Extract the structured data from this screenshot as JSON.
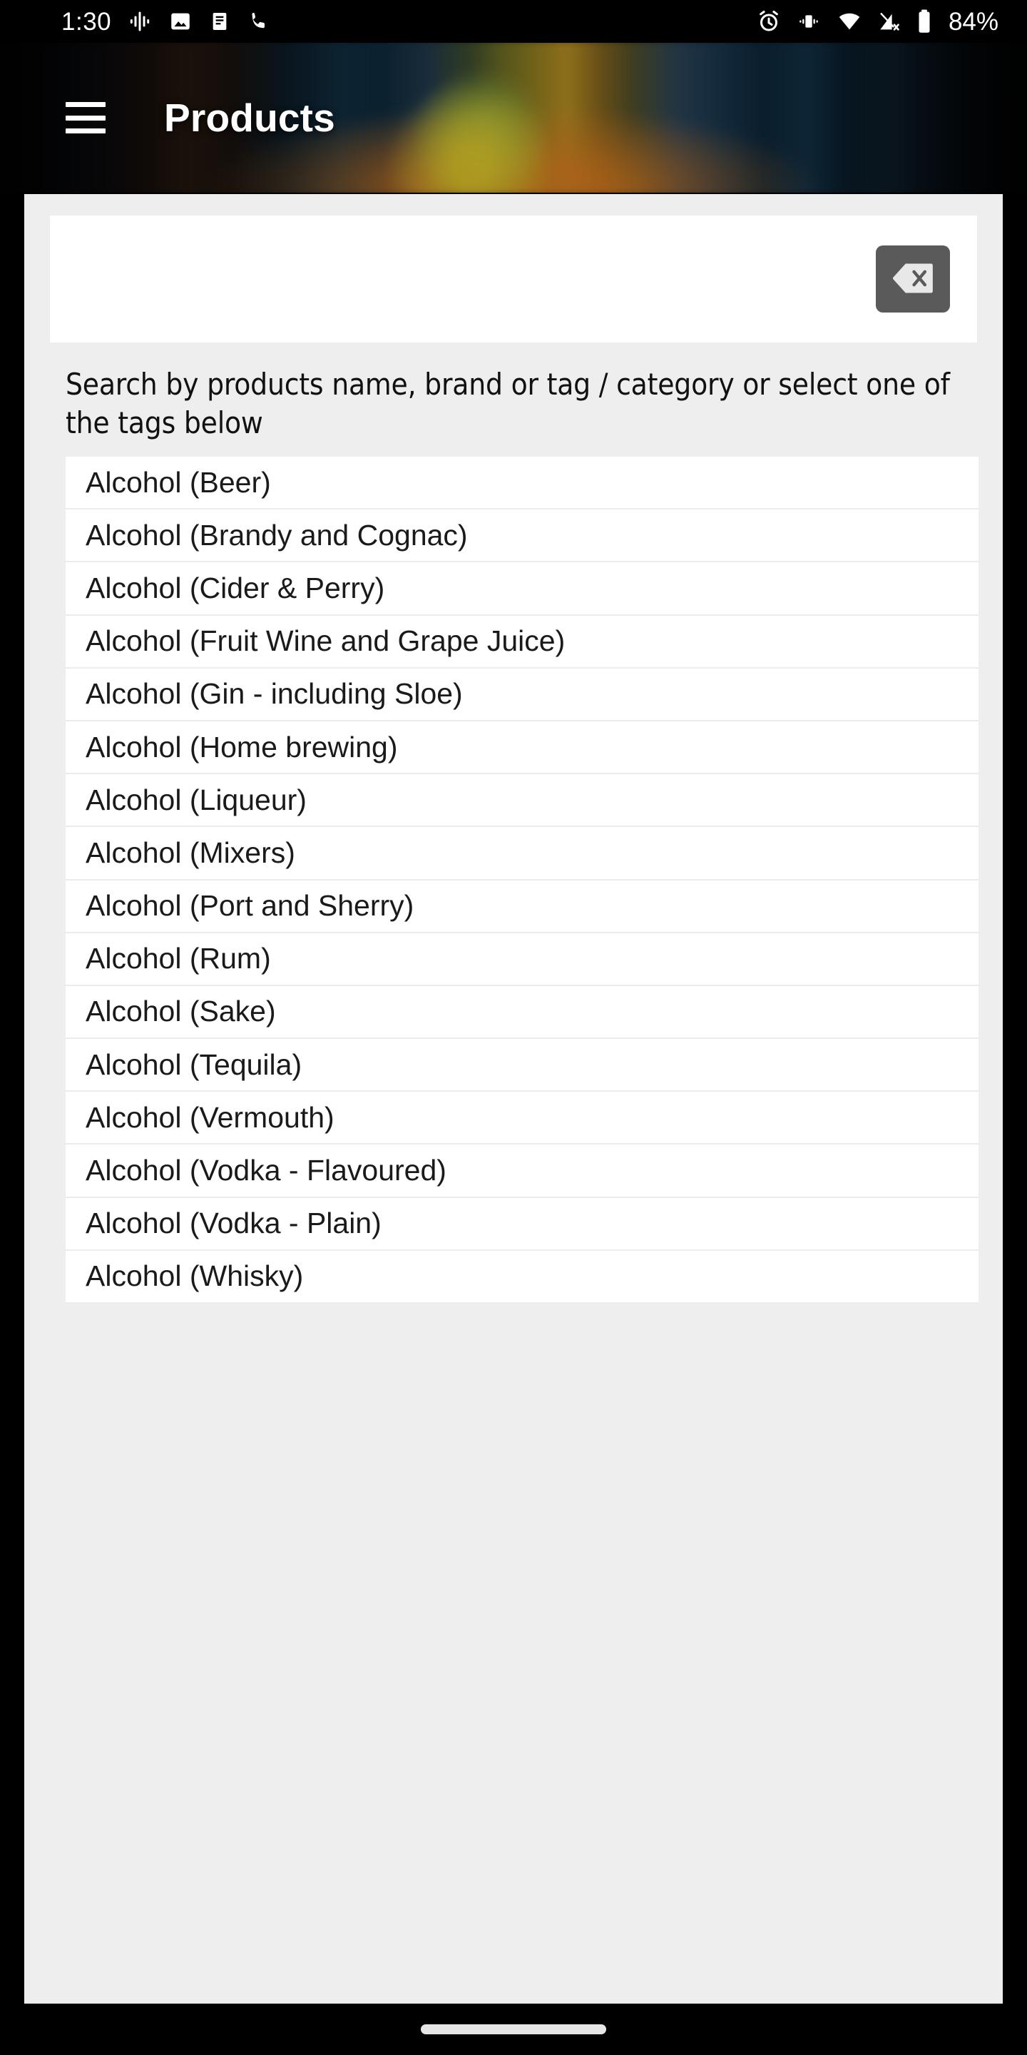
{
  "statusbar": {
    "time": "1:30",
    "battery_percent": "84%",
    "left_icons": [
      "assistant-dots-icon",
      "image-icon",
      "document-icon",
      "phone-call-icon"
    ],
    "right_icons": [
      "alarm-icon",
      "vibrate-icon",
      "wifi-icon",
      "mobile-signal-off-icon",
      "battery-icon"
    ]
  },
  "appbar": {
    "menu_icon": "hamburger-menu-icon",
    "title": "Products"
  },
  "search": {
    "value": "",
    "placeholder": "",
    "clear_icon": "backspace-delete-icon"
  },
  "hint": {
    "text": "Search by products name, brand or tag / category or select one of the tags below"
  },
  "tags": [
    {
      "label": "Alcohol (Beer)"
    },
    {
      "label": "Alcohol (Brandy and Cognac)"
    },
    {
      "label": "Alcohol (Cider & Perry)"
    },
    {
      "label": "Alcohol (Fruit Wine and Grape Juice)"
    },
    {
      "label": "Alcohol (Gin - including Sloe)"
    },
    {
      "label": "Alcohol (Home brewing)"
    },
    {
      "label": "Alcohol (Liqueur)"
    },
    {
      "label": "Alcohol (Mixers)"
    },
    {
      "label": "Alcohol (Port and Sherry)"
    },
    {
      "label": "Alcohol (Rum)"
    },
    {
      "label": "Alcohol (Sake)"
    },
    {
      "label": "Alcohol (Tequila)"
    },
    {
      "label": "Alcohol (Vermouth)"
    },
    {
      "label": "Alcohol (Vodka - Flavoured)"
    },
    {
      "label": "Alcohol (Vodka - Plain)"
    },
    {
      "label": "Alcohol (Whisky)"
    }
  ],
  "navbar": {
    "home_pill": "gesture-home-pill"
  },
  "colors": {
    "panel_bg": "#eeeeee",
    "card_bg": "#ffffff",
    "clear_button_bg": "#5a5a5a",
    "separator": "#ececec",
    "status_bg": "#000000"
  }
}
